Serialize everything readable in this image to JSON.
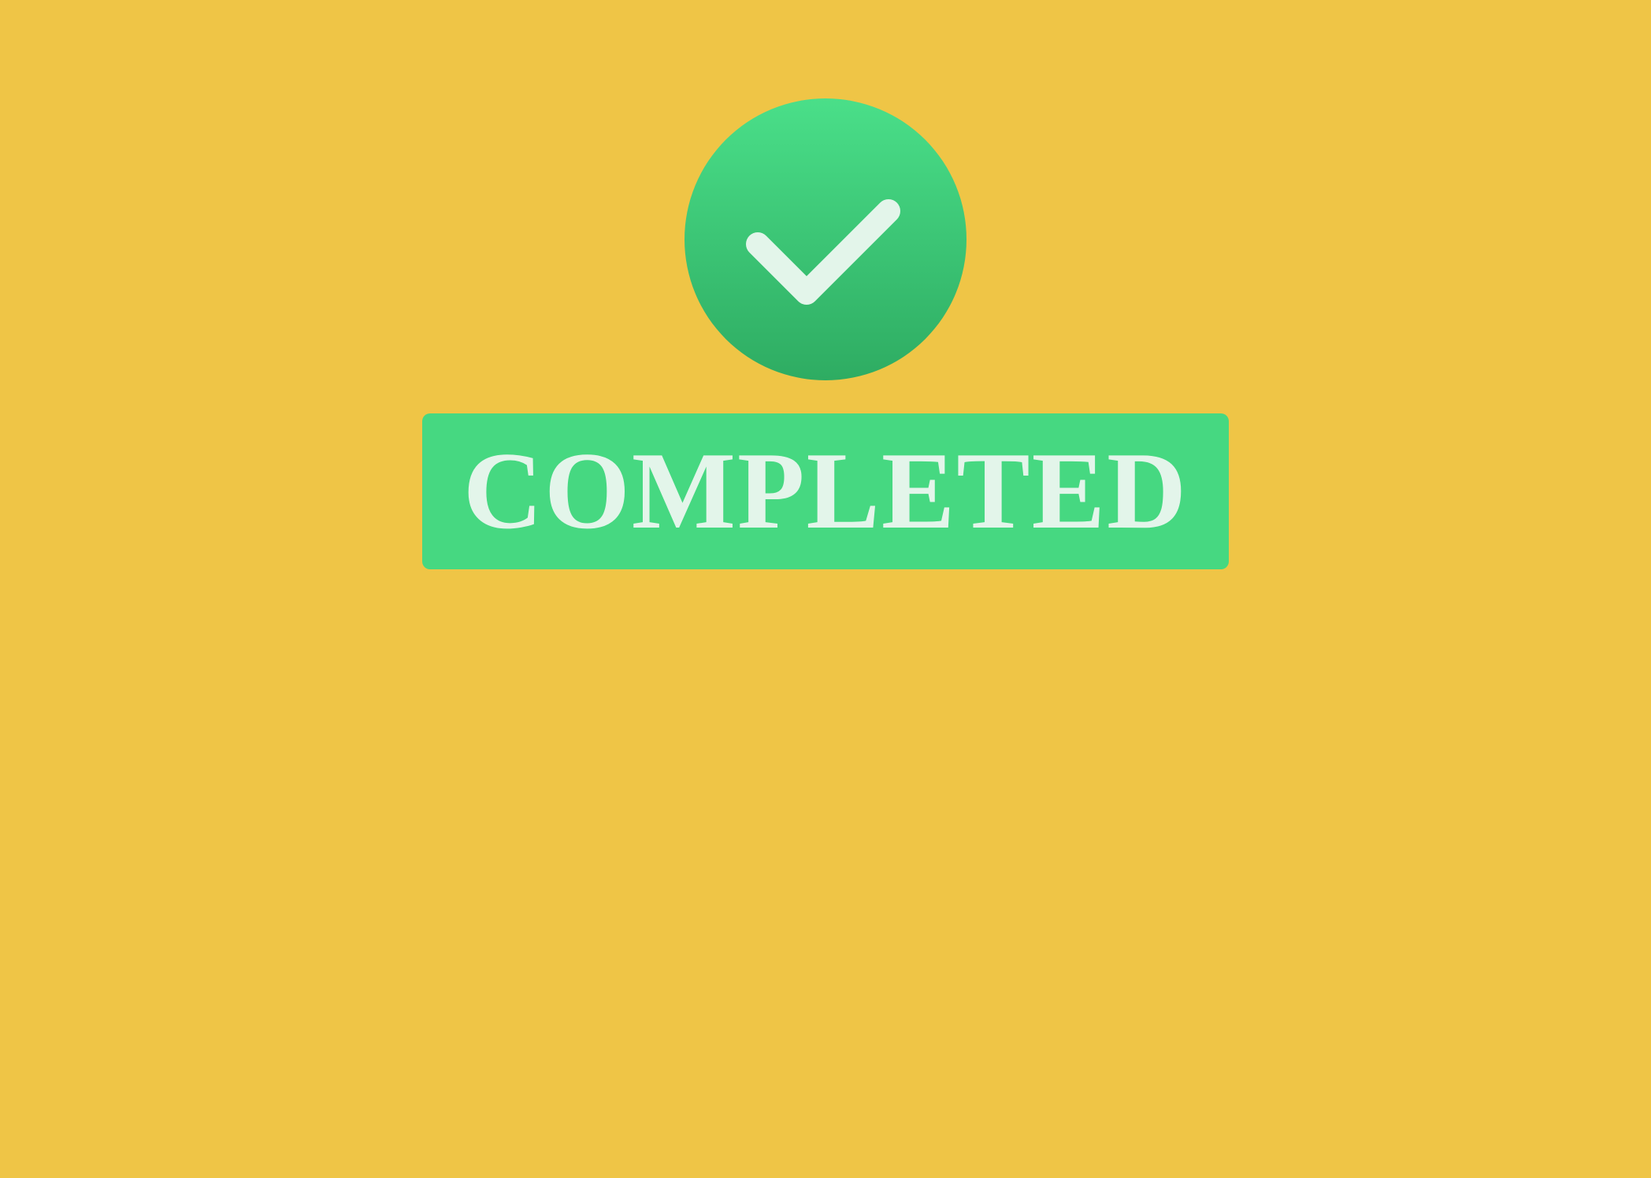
{
  "status": {
    "label": "COMPLETED",
    "icon": "check-icon"
  },
  "colors": {
    "background": "#EFC546",
    "badge_top": "#4ADF89",
    "badge_bottom": "#2EAC62",
    "banner": "#46D881",
    "foreground": "#E3F5EA"
  }
}
